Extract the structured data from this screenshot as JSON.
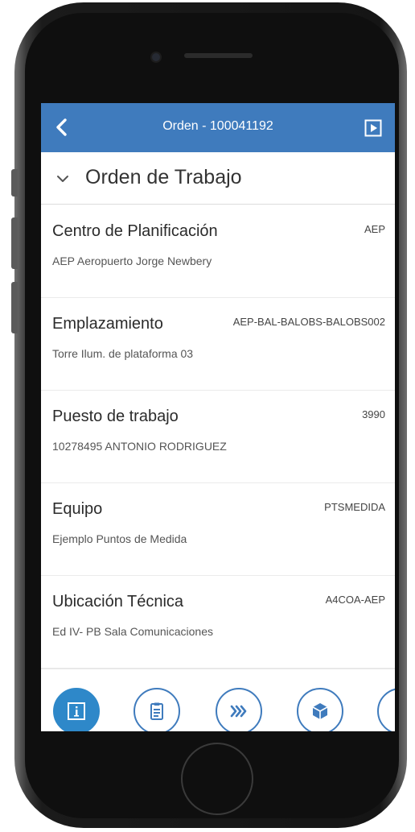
{
  "header": {
    "title": "Orden - 100041192",
    "back_icon": "chevron-left-icon",
    "action_icon": "play-box-icon"
  },
  "section": {
    "title": "Orden de Trabajo",
    "toggle_icon": "chevron-down-icon"
  },
  "fields": [
    {
      "label": "Centro de Planificación",
      "code": "AEP",
      "desc": "AEP Aeropuerto Jorge Newbery"
    },
    {
      "label": "Emplazamiento",
      "code": "AEP-BAL-BALOBS-BALOBS002",
      "desc": "Torre Ilum. de plataforma 03"
    },
    {
      "label": "Puesto de trabajo",
      "code": "3990",
      "desc": "10278495 ANTONIO RODRIGUEZ"
    },
    {
      "label": "Equipo",
      "code": "PTSMEDIDA",
      "desc": "Ejemplo Puntos de Medida"
    },
    {
      "label": "Ubicación Técnica",
      "code": "A4COA-AEP",
      "desc": "Ed IV- PB Sala Comunicaciones"
    }
  ],
  "bottom_bar": {
    "buttons": [
      {
        "icon": "info-icon",
        "active": true
      },
      {
        "icon": "clipboard-icon",
        "active": false
      },
      {
        "icon": "fast-forward-chevrons-icon",
        "active": false
      },
      {
        "icon": "cube-icon",
        "active": false
      },
      {
        "icon": "chevron-right-icon",
        "active": false
      }
    ]
  },
  "colors": {
    "primary": "#3f7bbd",
    "active_button": "#2e88c9",
    "text": "#2b2b2b",
    "divider": "#ebebeb"
  }
}
